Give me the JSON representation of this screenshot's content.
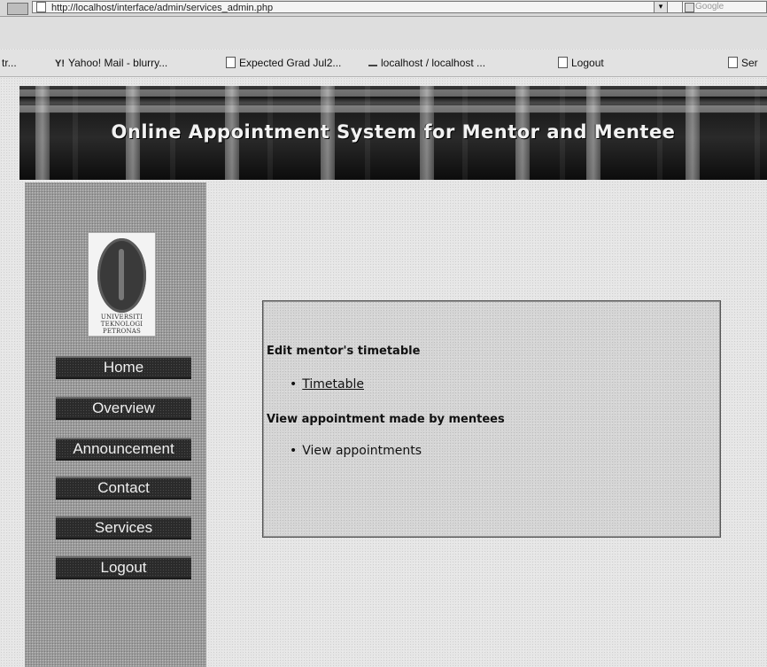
{
  "browser": {
    "url": "http://localhost/interface/admin/services_admin.php",
    "search_placeholder": "Google",
    "bookmarks": [
      {
        "label": "tr..."
      },
      {
        "label": "Yahoo! Mail - blurry..."
      },
      {
        "label": "Expected Grad Jul2..."
      },
      {
        "label": "localhost / localhost ..."
      },
      {
        "label": "Logout"
      },
      {
        "label": "Ser"
      }
    ]
  },
  "header": {
    "title": "Online Appointment System for Mentor and Mentee"
  },
  "logo": {
    "line1": "UNIVERSITI",
    "line2": "TEKNOLOGI",
    "line3": "PETRONAS"
  },
  "sidebar": {
    "items": [
      {
        "label": "Home"
      },
      {
        "label": "Overview"
      },
      {
        "label": "Announcement"
      },
      {
        "label": "Contact"
      },
      {
        "label": "Services"
      },
      {
        "label": "Logout"
      }
    ]
  },
  "services": {
    "section1_heading": "Edit mentor's timetable",
    "section1_link": "Timetable",
    "section2_heading": "View appointment made by mentees",
    "section2_link": "View appointments"
  }
}
